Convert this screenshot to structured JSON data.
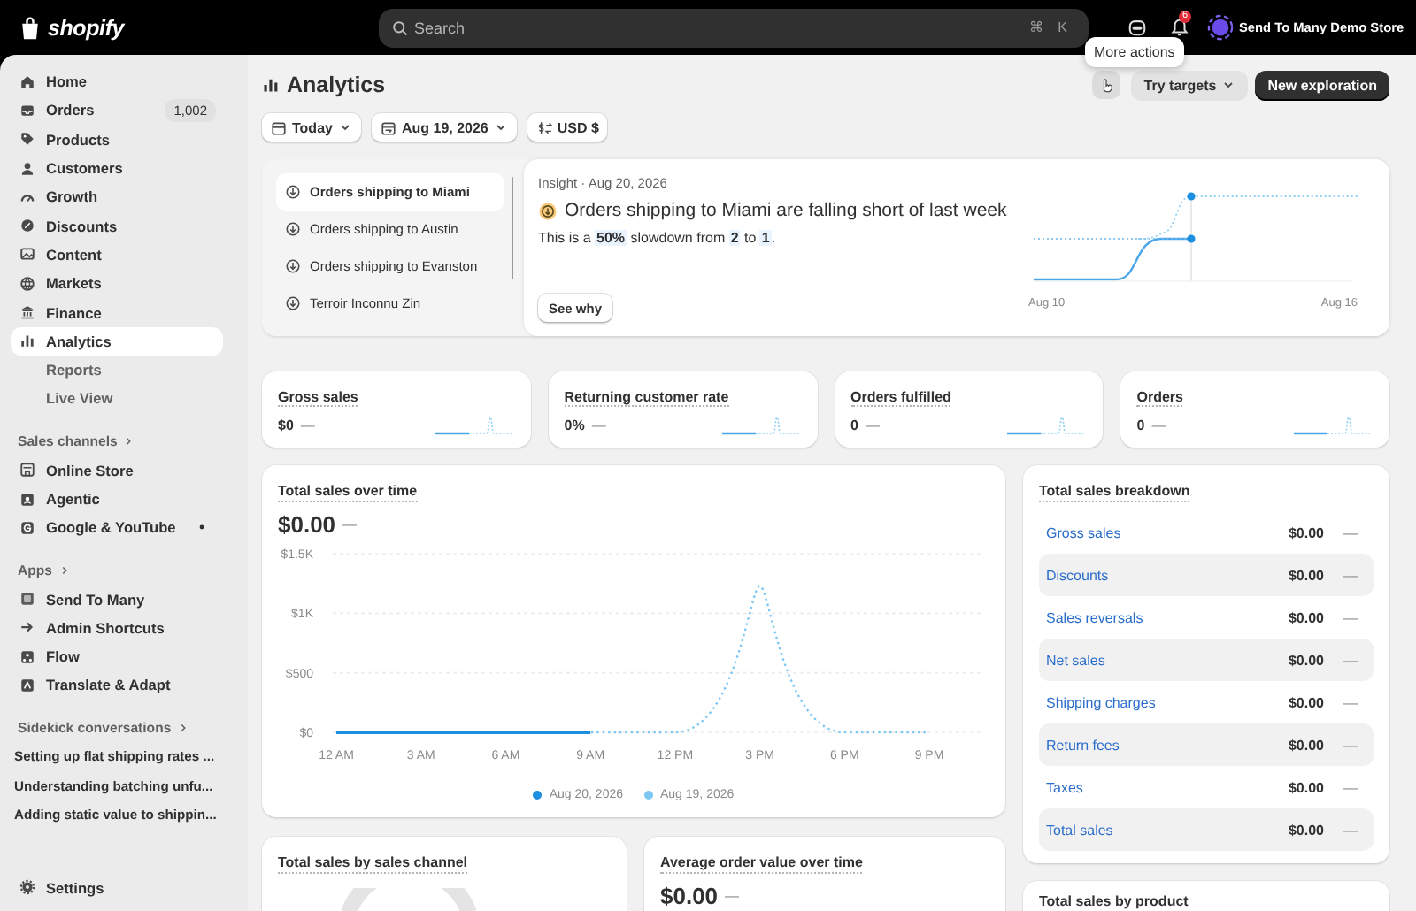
{
  "topbar": {
    "logo": "shopify",
    "search": {
      "placeholder": "Search",
      "shortcut": [
        "⌘",
        "K"
      ]
    },
    "notification_count": "6",
    "store_name": "Send To Many Demo Store"
  },
  "tooltip": "More actions",
  "sidebar": {
    "items": [
      {
        "label": "Home",
        "selected": false
      },
      {
        "label": "Orders",
        "badge": "1,002",
        "selected": false
      },
      {
        "label": "Products",
        "selected": false
      },
      {
        "label": "Customers",
        "selected": false
      },
      {
        "label": "Growth",
        "selected": false
      },
      {
        "label": "Discounts",
        "selected": false
      },
      {
        "label": "Content",
        "selected": false
      },
      {
        "label": "Markets",
        "selected": false
      },
      {
        "label": "Finance",
        "selected": false
      },
      {
        "label": "Analytics",
        "selected": true,
        "children": [
          {
            "label": "Reports",
            "selected": false
          },
          {
            "label": "Live View",
            "selected": false
          }
        ]
      }
    ],
    "sections": [
      {
        "title": "Sales channels",
        "kind": "icons",
        "items": [
          {
            "label": "Online Store"
          },
          {
            "label": "Agentic"
          },
          {
            "label": "Google & YouTube",
            "pinned": false
          }
        ]
      },
      {
        "title": "Apps",
        "kind": "icons",
        "items": [
          {
            "label": "Send To Many"
          },
          {
            "label": "Admin Shortcuts"
          },
          {
            "label": "Flow"
          },
          {
            "label": "Translate & Adapt"
          }
        ]
      },
      {
        "title": "Sidekick conversations",
        "kind": "text",
        "items": [
          {
            "label": "Setting up flat shipping rates ..."
          },
          {
            "label": "Understanding batching unfu..."
          },
          {
            "label": "Adding static value to shippin..."
          }
        ]
      }
    ],
    "footer": "Settings"
  },
  "header": {
    "title": "Analytics",
    "buttons": [
      {
        "label": "Try targets",
        "kind": "menu"
      },
      {
        "label": "New exploration",
        "kind": "primary"
      }
    ]
  },
  "filters": [
    {
      "label": "Today",
      "kind": "calendar"
    },
    {
      "label": "Aug 19, 2026",
      "kind": "compare"
    },
    {
      "label": "USD $",
      "kind": "currency"
    }
  ],
  "insight": {
    "items": [
      {
        "label": "Orders shipping to Miami",
        "selected": true
      },
      {
        "label": "Orders shipping to Austin",
        "selected": false
      },
      {
        "label": "Orders shipping to Evanston",
        "selected": false
      },
      {
        "label": "Terroir Inconnu Zin",
        "selected": false
      }
    ],
    "date": "Insight · Aug 20, 2026",
    "title": "Orders shipping to Miami are falling short of last week",
    "summary": "This is a **50%** slowdown from **2** to **1**.",
    "button": "See why",
    "chart_labels": [
      "Aug 10",
      "Aug 16"
    ]
  },
  "kpis": [
    {
      "title": "Gross sales",
      "value": "$0",
      "change": "—"
    },
    {
      "title": "Returning customer rate",
      "value": "0%",
      "change": "—"
    },
    {
      "title": "Orders fulfilled",
      "value": "0",
      "change": "—"
    },
    {
      "title": "Orders",
      "value": "0",
      "change": "—"
    }
  ],
  "sales_chart": {
    "title": "Total sales over time",
    "value": "$0.00",
    "change": "—",
    "chart_data": {
      "type": "line",
      "categories": [
        "12 AM",
        "3 AM",
        "6 AM",
        "9 AM",
        "12 PM",
        "3 PM",
        "6 PM",
        "9 PM"
      ],
      "ylim": [
        0,
        1500
      ],
      "yticks": [
        {
          "value": 0,
          "label": "$0"
        },
        {
          "value": 500,
          "label": "$500"
        },
        {
          "value": 1000,
          "label": "$1K"
        },
        {
          "value": 1500,
          "label": "$1.5K"
        }
      ],
      "series": [
        {
          "name": "Aug 20, 2026",
          "color": "#1d8fe1",
          "line_style": "solid",
          "values": [
            0,
            0,
            0,
            0,
            null,
            null,
            null,
            null
          ]
        },
        {
          "name": "Aug 19, 2026",
          "color": "#7cc8f2",
          "line_style": "dotted",
          "values": [
            0,
            0,
            0,
            0,
            0,
            1230,
            0,
            0
          ]
        }
      ]
    }
  },
  "breakdown": {
    "title": "Total sales breakdown",
    "rows": [
      {
        "label": "Gross sales",
        "value": "$0.00",
        "change": "—"
      },
      {
        "label": "Discounts",
        "value": "$0.00",
        "change": "—"
      },
      {
        "label": "Sales reversals",
        "value": "$0.00",
        "change": "—"
      },
      {
        "label": "Net sales",
        "value": "$0.00",
        "change": "—"
      },
      {
        "label": "Shipping charges",
        "value": "$0.00",
        "change": "—"
      },
      {
        "label": "Return fees",
        "value": "$0.00",
        "change": "—"
      },
      {
        "label": "Taxes",
        "value": "$0.00",
        "change": "—"
      },
      {
        "label": "Total sales",
        "value": "$0.00",
        "change": "—"
      }
    ]
  },
  "bottom_cards": [
    {
      "title": "Total sales by sales channel",
      "kind": "donut"
    },
    {
      "title": "Average order value over time",
      "kind": "metric",
      "value": "$0.00",
      "change": "—"
    }
  ],
  "product_card": {
    "title": "Total sales by product"
  }
}
